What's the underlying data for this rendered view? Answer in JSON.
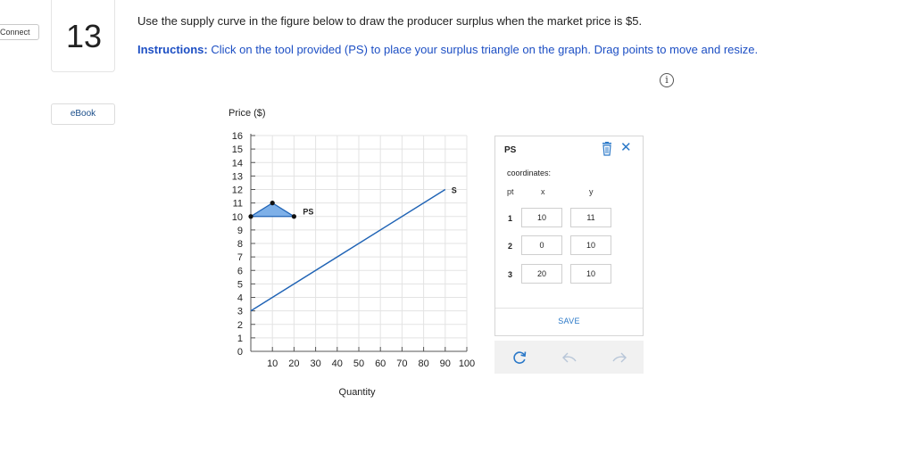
{
  "nav": {
    "connect_label": "Connect",
    "question_number": "13",
    "ebook_label": "eBook"
  },
  "question": {
    "prompt": "Use the supply curve in the figure below to draw the producer surplus when the market price is $5.",
    "instructions_lead": "Instructions:",
    "instructions_body": " Click on the tool provided (PS) to place your surplus triangle on the graph. Drag points to move and resize.",
    "info_icon": "i"
  },
  "chart_data": {
    "type": "line",
    "ylabel": "Price ($)",
    "xlabel": "Quantity",
    "xlim": [
      0,
      100
    ],
    "ylim": [
      0,
      16
    ],
    "x_ticks": [
      10,
      20,
      30,
      40,
      50,
      60,
      70,
      80,
      90,
      100
    ],
    "y_ticks": [
      16,
      15,
      14,
      13,
      12,
      11,
      10,
      9,
      8,
      7,
      6,
      5,
      4,
      3,
      2,
      1
    ],
    "origin_label": "0",
    "grid": true,
    "series": [
      {
        "name": "S",
        "points": [
          [
            0,
            3
          ],
          [
            90,
            12
          ]
        ],
        "color": "#1f63b5"
      }
    ],
    "shapes": [
      {
        "label": "PS",
        "points": [
          [
            10,
            11
          ],
          [
            0,
            10
          ],
          [
            20,
            10
          ]
        ],
        "fill": "#7eb0e8",
        "stroke": "#1f63b5"
      }
    ]
  },
  "tool_panel": {
    "title": "PS",
    "coordinates_label": "coordinates:",
    "col_pt": "pt",
    "col_x": "x",
    "col_y": "y",
    "rows": [
      {
        "pt": "1",
        "x": "10",
        "y": "11"
      },
      {
        "pt": "2",
        "x": "0",
        "y": "10"
      },
      {
        "pt": "3",
        "x": "20",
        "y": "10"
      }
    ],
    "save_label": "SAVE",
    "accent": "#2a78c8"
  },
  "toolbar": {
    "icons": [
      "reset-icon",
      "undo-icon",
      "redo-icon"
    ]
  }
}
